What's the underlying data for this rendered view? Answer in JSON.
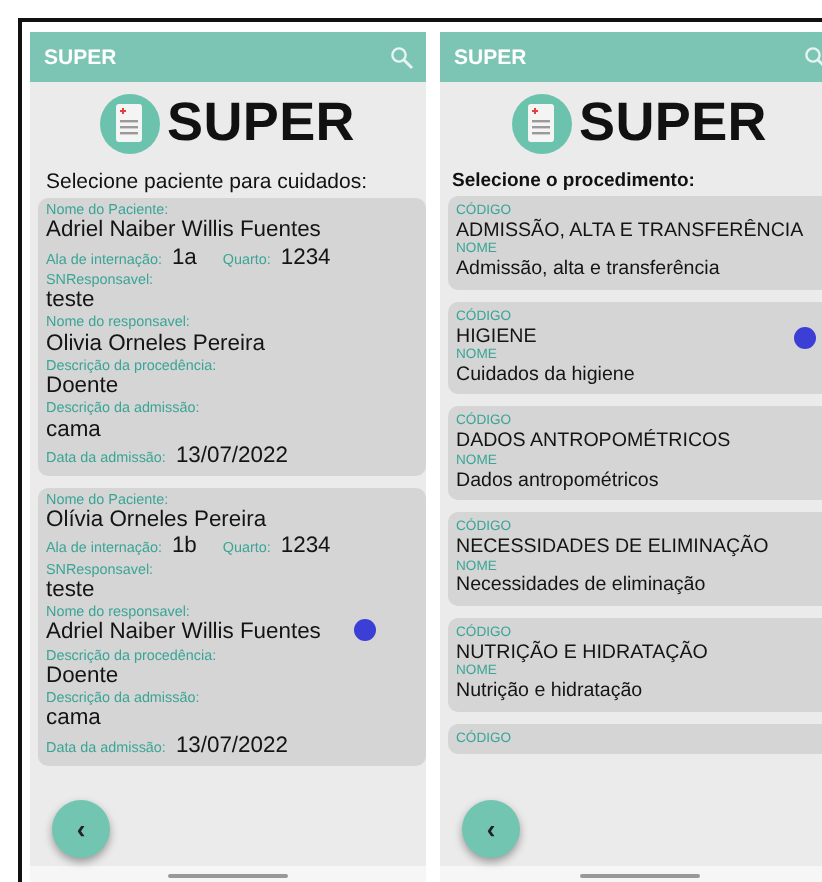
{
  "screens": [
    {
      "kind": "patients",
      "header": {
        "title": "SUPER"
      },
      "logo": {
        "text": "SUPER"
      },
      "subtitle": "Selecione paciente para cuidados:",
      "back_button": {
        "label": "‹"
      },
      "cards": [
        {
          "touched": false,
          "fields": [
            {
              "kind": "stacked",
              "label": "Nome do Paciente:",
              "value": "Adriel Naiber Willis Fuentes"
            },
            {
              "kind": "inline",
              "pairs": [
                {
                  "label": "Ala de internação:",
                  "value": "1a"
                },
                {
                  "label": "Quarto:",
                  "value": "1234"
                }
              ]
            },
            {
              "kind": "stacked",
              "label": "SNResponsavel:",
              "value": "teste"
            },
            {
              "kind": "stacked",
              "label": "Nome do responsavel:",
              "value": "Olivia Orneles Pereira"
            },
            {
              "kind": "stacked",
              "label": "Descrição da procedência:",
              "value": "Doente"
            },
            {
              "kind": "stacked",
              "label": "Descrição da admissão:",
              "value": "cama"
            },
            {
              "kind": "inline",
              "pairs": [
                {
                  "label": "Data da admissão:",
                  "value": "13/07/2022"
                }
              ]
            }
          ]
        },
        {
          "touched": true,
          "fields": [
            {
              "kind": "stacked",
              "label": "Nome do Paciente:",
              "value": "Olívia Orneles Pereira"
            },
            {
              "kind": "inline",
              "pairs": [
                {
                  "label": "Ala de internação:",
                  "value": "1b"
                },
                {
                  "label": "Quarto:",
                  "value": "1234"
                }
              ]
            },
            {
              "kind": "stacked",
              "label": "SNResponsavel:",
              "value": "teste"
            },
            {
              "kind": "stacked",
              "label": "Nome do responsavel:",
              "value": "Adriel Naiber Willis Fuentes"
            },
            {
              "kind": "stacked",
              "label": "Descrição da procedência:",
              "value": "Doente"
            },
            {
              "kind": "stacked",
              "label": "Descrição da admissão:",
              "value": "cama"
            },
            {
              "kind": "inline",
              "pairs": [
                {
                  "label": "Data da admissão:",
                  "value": "13/07/2022"
                }
              ]
            }
          ]
        }
      ]
    },
    {
      "kind": "procedures",
      "header": {
        "title": "SUPER"
      },
      "logo": {
        "text": "SUPER"
      },
      "subtitle": "Selecione o procedimento:",
      "back_button": {
        "label": "‹"
      },
      "cards": [
        {
          "touched": false,
          "fields": [
            {
              "kind": "stacked",
              "label": "CÓDIGO",
              "value": "ADMISSÃO, ALTA E TRANSFERÊNCIA"
            },
            {
              "kind": "stacked",
              "label": "NOME",
              "value": "Admissão, alta e transferência"
            }
          ]
        },
        {
          "touched": true,
          "fields": [
            {
              "kind": "stacked",
              "label": "CÓDIGO",
              "value": "HIGIENE"
            },
            {
              "kind": "stacked",
              "label": "NOME",
              "value": "Cuidados da higiene"
            }
          ]
        },
        {
          "touched": false,
          "fields": [
            {
              "kind": "stacked",
              "label": "CÓDIGO",
              "value": "DADOS ANTROPOMÉTRICOS"
            },
            {
              "kind": "stacked",
              "label": "NOME",
              "value": "Dados antropométricos"
            }
          ]
        },
        {
          "touched": false,
          "fields": [
            {
              "kind": "stacked",
              "label": "CÓDIGO",
              "value": "NECESSIDADES DE ELIMINAÇÃO"
            },
            {
              "kind": "stacked",
              "label": "NOME",
              "value": "Necessidades de eliminação"
            }
          ]
        },
        {
          "touched": false,
          "fields": [
            {
              "kind": "stacked",
              "label": "CÓDIGO",
              "value": "NUTRIÇÃO E HIDRATAÇÃO"
            },
            {
              "kind": "stacked",
              "label": "NOME",
              "value": "Nutrição e hidratação"
            }
          ]
        },
        {
          "touched": false,
          "fields": [
            {
              "kind": "label_only",
              "label": "CÓDIGO"
            }
          ]
        }
      ]
    }
  ]
}
